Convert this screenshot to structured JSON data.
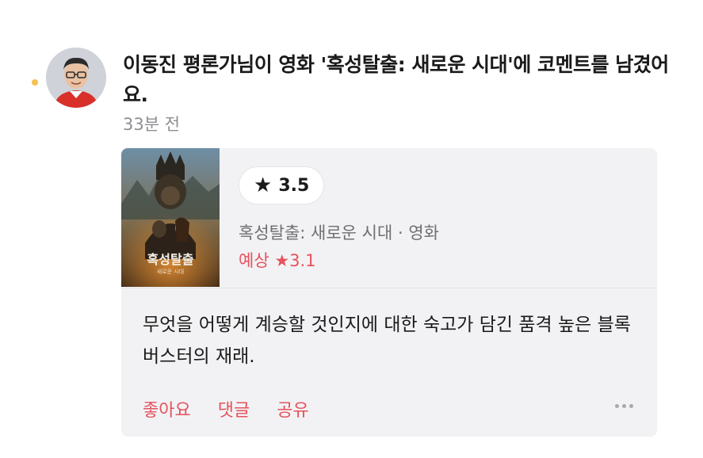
{
  "feed_item": {
    "headline": "이동진 평론가님이 영화 '혹성탈출: 새로운 시대'에 코멘트를 남겼어요.",
    "timestamp": "33분 전"
  },
  "card": {
    "poster": {
      "title_text": "혹성탈출",
      "subtitle_text": "새로운 시대"
    },
    "rating": {
      "icon": "star-icon",
      "value": "3.5"
    },
    "movie_line": "혹성탈출: 새로운 시대 · 영화",
    "expected_rating": "예상 ★3.1",
    "comment": "무엇을 어떻게 계승할 것인지에 대한 숙고가 담긴 품격 높은 블록버스터의 재래."
  },
  "actions": {
    "like": "좋아요",
    "comment": "댓글",
    "share": "공유",
    "more_icon": "more-horizontal-icon"
  },
  "colors": {
    "accent": "#e5525d",
    "muted": "#8e8e93",
    "card_bg": "#f2f2f4",
    "unread_dot": "#f2c14e"
  }
}
